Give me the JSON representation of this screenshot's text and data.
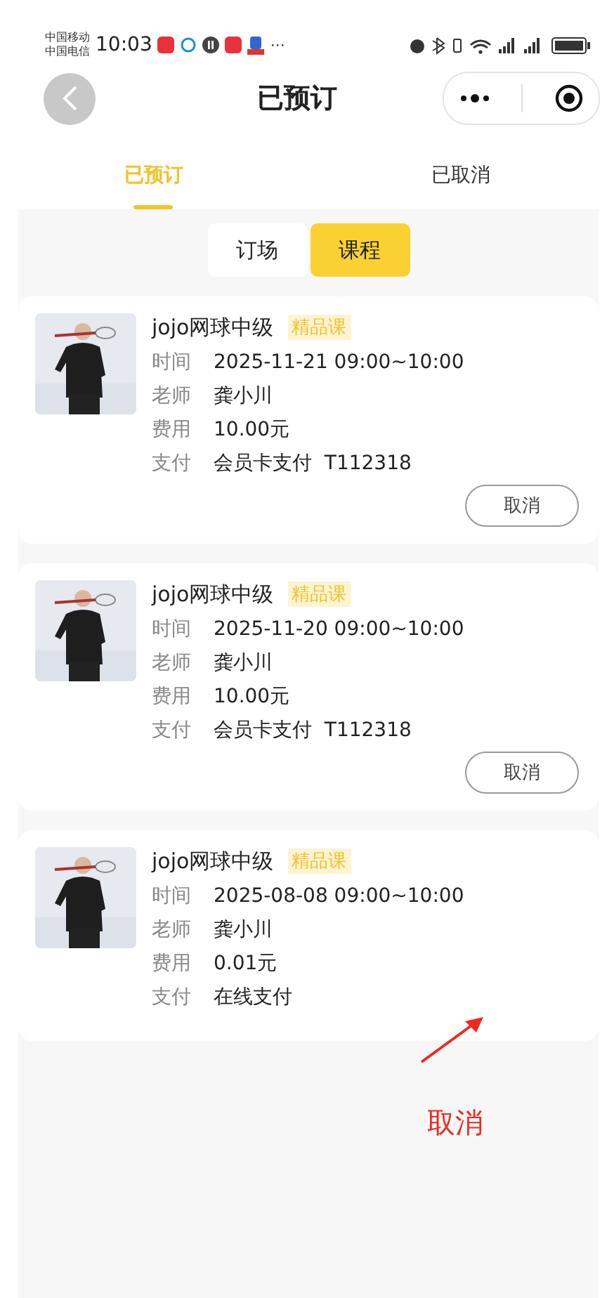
{
  "status_bar": {
    "carriers": [
      "中国移动",
      "中国电信"
    ],
    "time": "10:03",
    "more": "···"
  },
  "nav": {
    "title": "已预订"
  },
  "tabs": [
    {
      "label": "已预订",
      "selected": true
    },
    {
      "label": "已取消",
      "selected": false
    }
  ],
  "segments": [
    {
      "label": "订场",
      "selected": false
    },
    {
      "label": "课程",
      "selected": true
    }
  ],
  "bookings": [
    {
      "title": "jojo网球中级",
      "tag": "精品课",
      "fields": [
        {
          "label": "时间",
          "value": "2025-11-21 09:00~10:00"
        },
        {
          "label": "老师",
          "value": "龚小川"
        },
        {
          "label": "费用",
          "value": "10.00元"
        },
        {
          "label": "支付",
          "value": "会员卡支付  T112318"
        }
      ],
      "cancel_button": "取消"
    },
    {
      "title": "jojo网球中级",
      "tag": "精品课",
      "fields": [
        {
          "label": "时间",
          "value": "2025-11-20 09:00~10:00"
        },
        {
          "label": "老师",
          "value": "龚小川"
        },
        {
          "label": "费用",
          "value": "10.00元"
        },
        {
          "label": "支付",
          "value": "会员卡支付  T112318"
        }
      ],
      "cancel_button": "取消"
    },
    {
      "title": "jojo网球中级",
      "tag": "精品课",
      "fields": [
        {
          "label": "时间",
          "value": "2025-08-08 09:00~10:00"
        },
        {
          "label": "老师",
          "value": "龚小川"
        },
        {
          "label": "费用",
          "value": "0.01元"
        },
        {
          "label": "支付",
          "value": "在线支付"
        }
      ]
    }
  ],
  "annotation": {
    "text": "取消"
  }
}
